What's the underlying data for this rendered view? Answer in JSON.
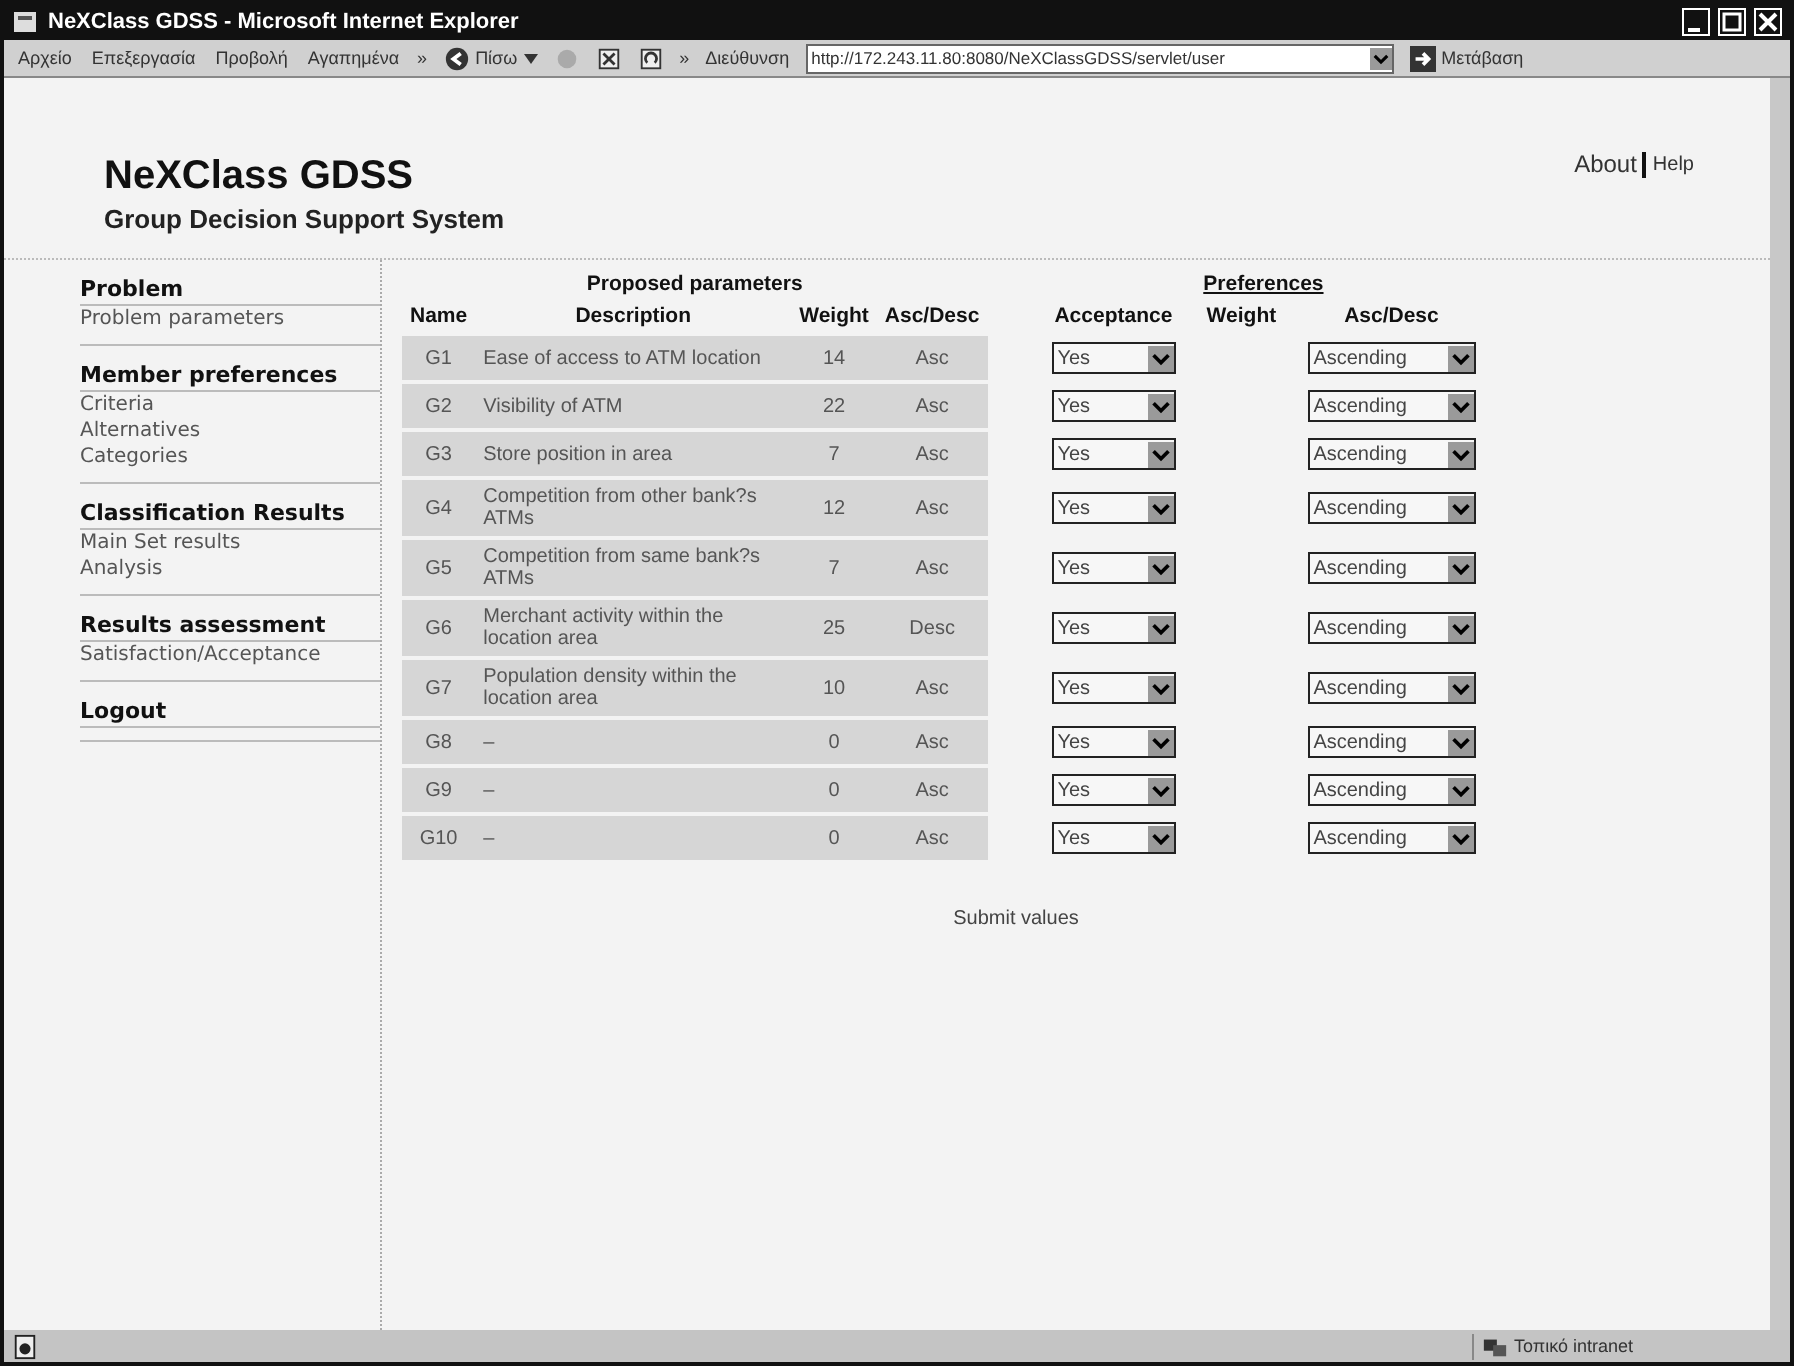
{
  "window": {
    "title": "NeXClass GDSS - Microsoft Internet Explorer"
  },
  "menu": [
    "Αρχείο",
    "Επεξεργασία",
    "Προβολή",
    "Αγαπημένα"
  ],
  "toolbar": {
    "overflow": [
      "»",
      "»"
    ],
    "back": "Πίσω",
    "address_label": "Διεύθυνση",
    "address": "http://172.243.11.80:8080/NeXClassGDSS/servlet/user",
    "go": "Μετάβαση"
  },
  "header": {
    "title": "NeXClass GDSS",
    "subtitle": "Group Decision Support System",
    "links": [
      "About",
      "Help"
    ]
  },
  "sidebar": [
    {
      "heading": "Problem",
      "items": [
        "Problem parameters"
      ]
    },
    {
      "heading": "Member preferences",
      "items": [
        "Criteria",
        "Alternatives",
        "Categories"
      ]
    },
    {
      "heading": "Classification Results",
      "items": [
        "Main Set results",
        "Analysis"
      ]
    },
    {
      "heading": "Results assessment",
      "items": [
        "Satisfaction/Acceptance"
      ]
    },
    {
      "heading": "Logout"
    }
  ],
  "table": {
    "proposed_heading": "Proposed parameters",
    "preferences_heading": "Preferences",
    "columns": [
      "Name",
      "Description",
      "Weight",
      "Asc/Desc",
      "Acceptance",
      "Weight",
      "Asc/Desc"
    ],
    "rows": [
      {
        "name": "G1",
        "description": "Ease of access to ATM location",
        "weight": "14",
        "order": "Asc",
        "acceptance": "Yes",
        "pref_order": "Ascending"
      },
      {
        "name": "G2",
        "description": "Visibility of ATM",
        "weight": "22",
        "order": "Asc",
        "acceptance": "Yes",
        "pref_order": "Ascending"
      },
      {
        "name": "G3",
        "description": "Store position in area",
        "weight": "7",
        "order": "Asc",
        "acceptance": "Yes",
        "pref_order": "Ascending"
      },
      {
        "name": "G4",
        "description": "Competition from other bank?s ATMs",
        "weight": "12",
        "order": "Asc",
        "acceptance": "Yes",
        "pref_order": "Ascending"
      },
      {
        "name": "G5",
        "description": "Competition from same bank?s ATMs",
        "weight": "7",
        "order": "Asc",
        "acceptance": "Yes",
        "pref_order": "Ascending"
      },
      {
        "name": "G6",
        "description": "Merchant activity within the location area",
        "weight": "25",
        "order": "Desc",
        "acceptance": "Yes",
        "pref_order": "Ascending"
      },
      {
        "name": "G7",
        "description": "Population density within the location area",
        "weight": "10",
        "order": "Asc",
        "acceptance": "Yes",
        "pref_order": "Ascending"
      },
      {
        "name": "G8",
        "description": "–",
        "weight": "0",
        "order": "Asc",
        "acceptance": "Yes",
        "pref_order": "Ascending"
      },
      {
        "name": "G9",
        "description": "–",
        "weight": "0",
        "order": "Asc",
        "acceptance": "Yes",
        "pref_order": "Ascending"
      },
      {
        "name": "G10",
        "description": "–",
        "weight": "0",
        "order": "Asc",
        "acceptance": "Yes",
        "pref_order": "Ascending"
      }
    ]
  },
  "submit": "Submit values",
  "status_bar": {
    "zone": "Τοπικό intranet"
  }
}
